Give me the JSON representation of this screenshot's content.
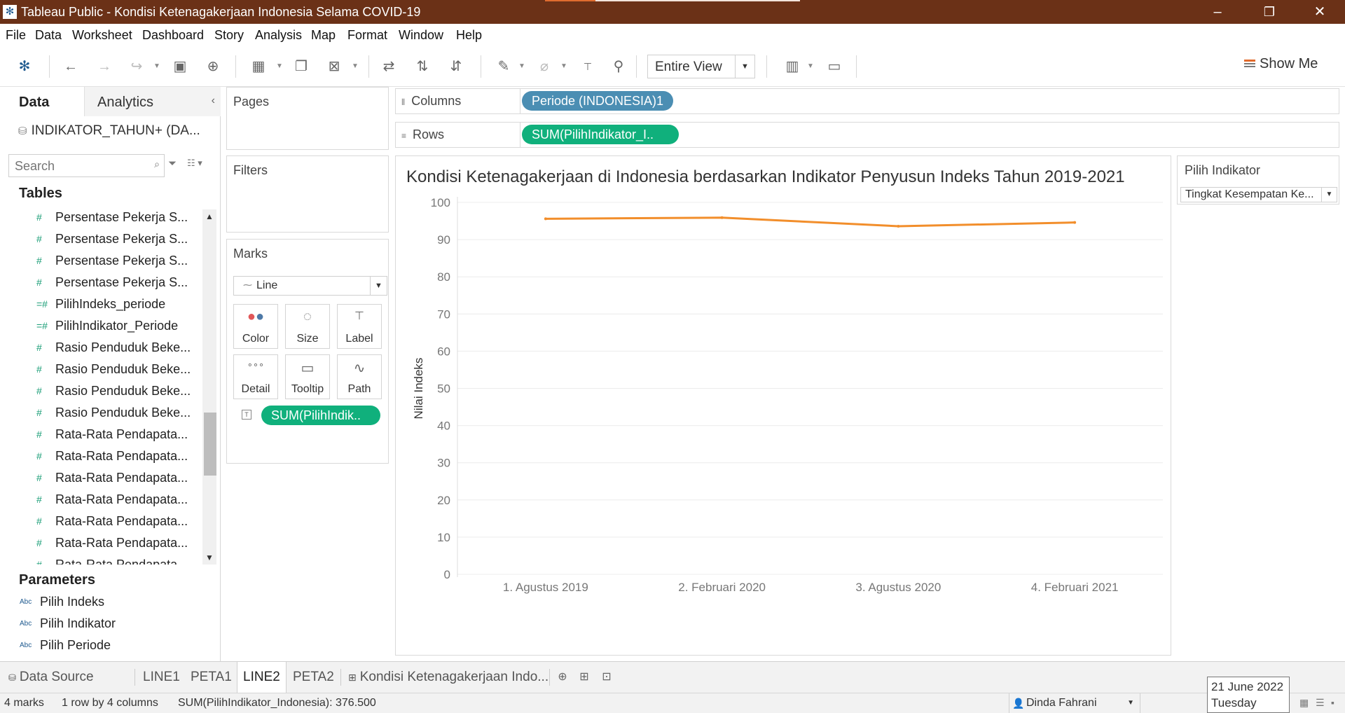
{
  "window": {
    "title": "Tableau Public - Kondisi Ketenagakerjaan Indonesia Selama COVID-19",
    "minimize": "–",
    "maximize": "❐",
    "close": "✕"
  },
  "menu": [
    "File",
    "Data",
    "Worksheet",
    "Dashboard",
    "Story",
    "Analysis",
    "Map",
    "Format",
    "Window",
    "Help"
  ],
  "toolbar": {
    "fit_select": "Entire View",
    "show_me": "Show Me"
  },
  "data_pane": {
    "tab_data": "Data",
    "tab_analytics": "Analytics",
    "datasource": "INDIKATOR_TAHUN+ (DA...",
    "search_placeholder": "Search",
    "tables_header": "Tables",
    "fields": [
      "Persentase Pekerja S...",
      "Persentase Pekerja S...",
      "Persentase Pekerja S...",
      "Persentase Pekerja S...",
      "PilihIndeks_periode",
      "PilihIndikator_Periode",
      "Rasio Penduduk Beke...",
      "Rasio Penduduk Beke...",
      "Rasio Penduduk Beke...",
      "Rasio Penduduk Beke...",
      "Rata-Rata Pendapata...",
      "Rata-Rata Pendapata...",
      "Rata-Rata Pendapata...",
      "Rata-Rata Pendapata...",
      "Rata-Rata Pendapata...",
      "Rata-Rata Pendapata...",
      "Rata-Rata Pendapata..."
    ],
    "parameters_header": "Parameters",
    "parameters": [
      "Pilih Indeks",
      "Pilih Indikator",
      "Pilih Periode"
    ]
  },
  "cards": {
    "pages": "Pages",
    "filters": "Filters",
    "marks": "Marks",
    "mark_type": "Line",
    "mark_buttons": [
      {
        "label": "Color",
        "icon": "color-icon"
      },
      {
        "label": "Size",
        "icon": "size-icon"
      },
      {
        "label": "Label",
        "icon": "label-icon"
      },
      {
        "label": "Detail",
        "icon": "detail-icon"
      },
      {
        "label": "Tooltip",
        "icon": "tooltip-icon"
      },
      {
        "label": "Path",
        "icon": "path-icon"
      }
    ],
    "marks_pill": "SUM(PilihIndik.."
  },
  "shelves": {
    "columns_label": "Columns",
    "columns_pill": "Periode (INDONESIA)1",
    "rows_label": "Rows",
    "rows_pill": "SUM(PilihIndikator_I.."
  },
  "viz": {
    "title": "Kondisi Ketenagakerjaan di Indonesia berdasarkan Indikator Penyusun Indeks Tahun 2019-2021"
  },
  "chart_data": {
    "type": "line",
    "title": "Kondisi Ketenagakerjaan di Indonesia berdasarkan Indikator Penyusun Indeks Tahun 2019-2021",
    "xlabel": "",
    "ylabel": "Nilai Indeks",
    "categories": [
      "1. Agustus 2019",
      "2. Februari 2020",
      "3. Agustus 2020",
      "4. Februari 2021"
    ],
    "series": [
      {
        "name": "",
        "values": [
          95.6,
          95.9,
          93.6,
          94.6
        ],
        "color": "#f28e2b"
      }
    ],
    "ylim": [
      0,
      100
    ],
    "yticks": [
      0,
      10,
      20,
      30,
      40,
      50,
      60,
      70,
      80,
      90,
      100
    ],
    "grid": true,
    "legend": "none"
  },
  "indicator_filter": {
    "title": "Pilih Indikator",
    "value": "Tingkat Kesempatan Ke..."
  },
  "sheet_tabs": {
    "data_source": "Data Source",
    "sheets": [
      "LINE1",
      "PETA1",
      "LINE2",
      "PETA2",
      "Kondisi Ketenagakerjaan Indo..."
    ],
    "active": "LINE2"
  },
  "status": {
    "marks": "4 marks",
    "rows_cols": "1 row by 4 columns",
    "sum": "SUM(PilihIndikator_Indonesia): 376.500",
    "user": "Dinda Fahrani",
    "date": "21 June 2022",
    "day": "Tuesday"
  },
  "colors": {
    "titlebar": "#6b3117",
    "pill_blue": "#4b8eb3",
    "pill_green": "#10b07c",
    "line": "#f28e2b"
  }
}
